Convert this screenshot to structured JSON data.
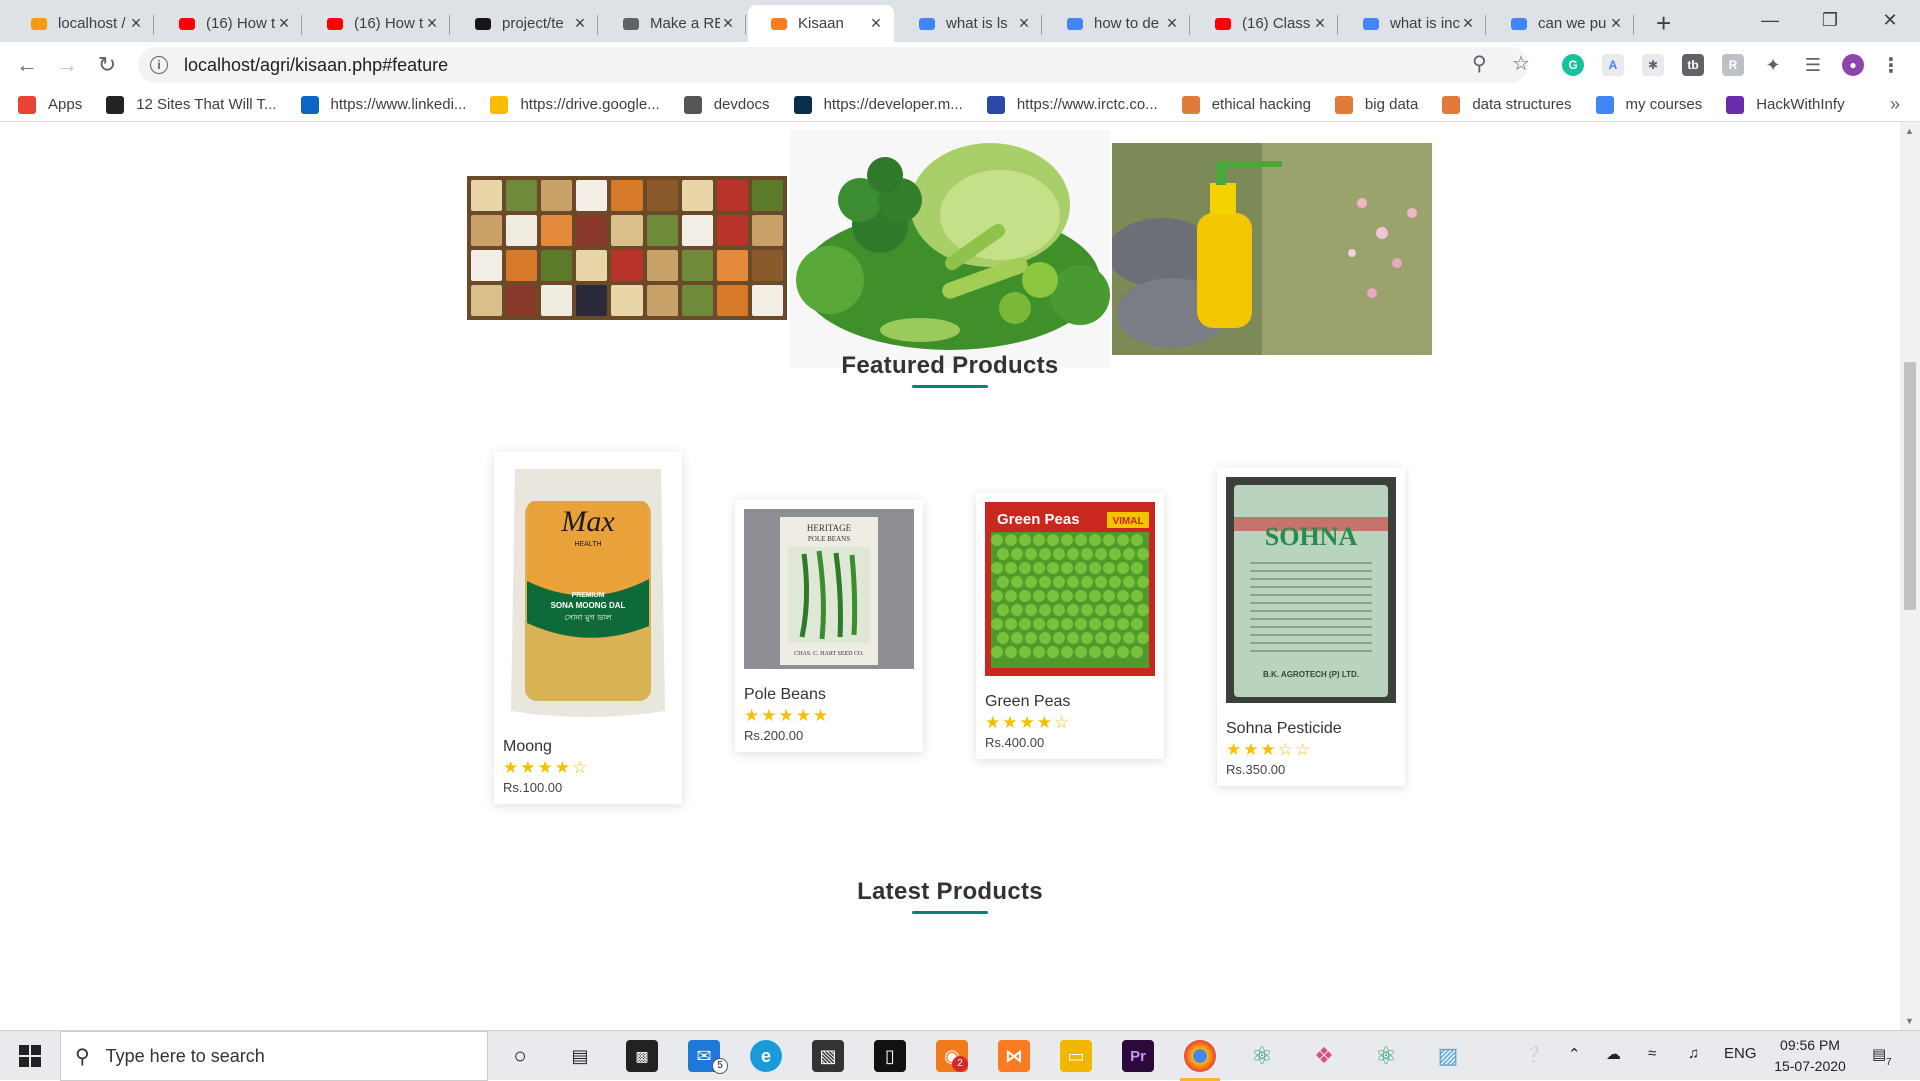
{
  "browser": {
    "tabs": [
      {
        "title": "localhost /",
        "icon": "phpmyadmin-icon",
        "color": "#f89c0e"
      },
      {
        "title": "(16) How t",
        "icon": "youtube-icon",
        "color": "#ff0000"
      },
      {
        "title": "(16) How t",
        "icon": "youtube-icon",
        "color": "#ff0000"
      },
      {
        "title": "project/te",
        "icon": "github-icon",
        "color": "#181717"
      },
      {
        "title": "Make a RE",
        "icon": "document-icon",
        "color": "#5f6368"
      },
      {
        "title": "Kisaan",
        "icon": "xampp-icon",
        "color": "#fb7a24",
        "active": true
      },
      {
        "title": "what is ls",
        "icon": "google-icon",
        "color": "#4285f4"
      },
      {
        "title": "how to de",
        "icon": "google-icon",
        "color": "#4285f4"
      },
      {
        "title": "(16) Class",
        "icon": "youtube-icon",
        "color": "#ff0000"
      },
      {
        "title": "what is inc",
        "icon": "google-icon",
        "color": "#4285f4"
      },
      {
        "title": "can we pu",
        "icon": "google-icon",
        "color": "#4285f4"
      }
    ],
    "url": "localhost/agri/kisaan.php#feature",
    "bookmarks": [
      {
        "label": "Apps",
        "icon": "apps-grid-icon"
      },
      {
        "label": "12 Sites That Will T...",
        "icon": "e-icon"
      },
      {
        "label": "https://www.linkedi...",
        "icon": "linkedin-icon"
      },
      {
        "label": "https://drive.google...",
        "icon": "google-drive-icon"
      },
      {
        "label": "devdocs",
        "icon": "devdocs-icon"
      },
      {
        "label": "https://developer.m...",
        "icon": "mdn-icon"
      },
      {
        "label": "https://www.irctc.co...",
        "icon": "irctc-icon"
      },
      {
        "label": "ethical hacking",
        "icon": "bookmark-site-icon"
      },
      {
        "label": "big data",
        "icon": "bookmark-site-icon"
      },
      {
        "label": "data structures",
        "icon": "bookmark-site-icon"
      },
      {
        "label": "my courses",
        "icon": "google-icon"
      },
      {
        "label": "HackWithInfy",
        "icon": "hackwithinfy-icon"
      }
    ]
  },
  "page": {
    "accent": "#088178",
    "featured_title": "Featured Products",
    "latest_title": "Latest Products",
    "products": [
      {
        "name": "Moong",
        "rating": 4,
        "price": "Rs.100.00",
        "image_text": {
          "brand": "Max",
          "sub": "HEALTH",
          "line1": "PREMIUM",
          "line2": "SONA MOONG DAL",
          "line3": "সোনা মুগ ডাল"
        }
      },
      {
        "name": "Pole Beans",
        "rating": 5,
        "price": "Rs.200.00",
        "image_text": {
          "top": "HERITAGE",
          "mid": "POLE BEANS",
          "bottom": "CHAS. C. HART SEED CO."
        }
      },
      {
        "name": "Green Peas",
        "rating": 4,
        "price": "Rs.400.00",
        "image_text": {
          "title": "Green Peas",
          "brand": "VIMAL"
        }
      },
      {
        "name": "Sohna Pesticide",
        "rating": 3,
        "price": "Rs.350.00",
        "image_text": {
          "brand": "SOHNA",
          "maker": "B.K. AGROTECH (P) LTD."
        }
      }
    ]
  },
  "taskbar": {
    "search_placeholder": "Type here to search",
    "mail_badge": "5",
    "app_badge": "2",
    "lang": "ENG",
    "time": "09:56 PM",
    "date": "15-07-2020",
    "notifications": "7"
  }
}
